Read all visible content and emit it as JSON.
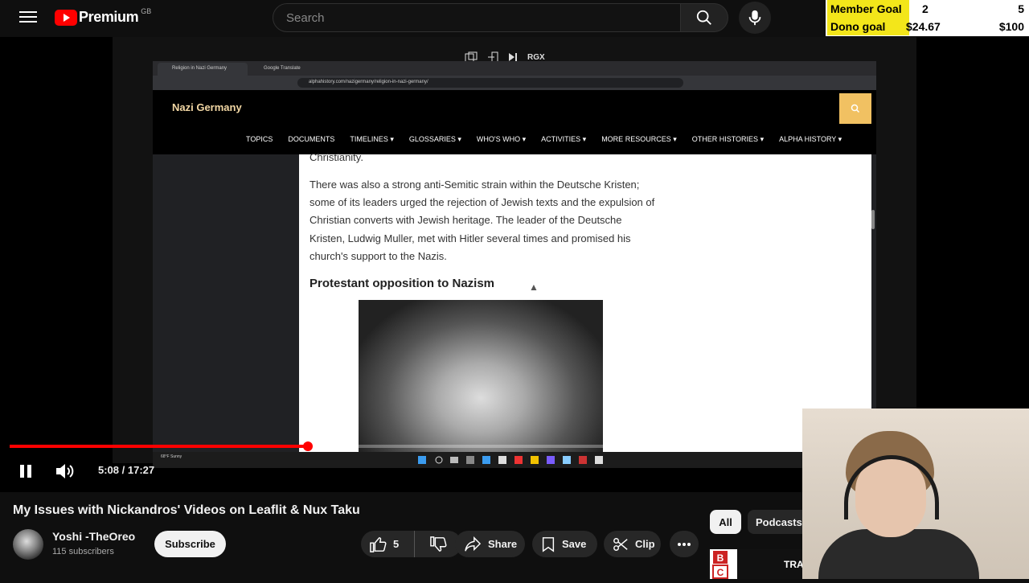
{
  "header": {
    "brand": "Premium",
    "region": "GB",
    "search_placeholder": "Search"
  },
  "goals": [
    {
      "label": "Member Goal",
      "current": "2",
      "target": "5"
    },
    {
      "label": "Dono goal",
      "current": "$24.67",
      "target": "$100"
    }
  ],
  "embedded_browser": {
    "tabs": [
      "Religion in Nazi Germany",
      "Google Translate"
    ],
    "url": "alphahistory.com/nazigermany/religion-in-nazi-germany/",
    "toolbar_label": "RGX",
    "site_title": "Nazi Germany",
    "nav": [
      "TOPICS",
      "DOCUMENTS",
      "TIMELINES ▾",
      "GLOSSARIES ▾",
      "WHO'S WHO ▾",
      "ACTIVITIES ▾",
      "MORE RESOURCES ▾",
      "OTHER HISTORIES ▾",
      "ALPHA HISTORY ▾"
    ],
    "paragraph_top": "Christianity.",
    "paragraph_1": "There was also a strong anti-Semitic strain within the Deutsche Kristen; some of its leaders urged the rejection of Jewish texts and the expulsion of Christian converts with Jewish heritage. The leader of the Deutsche Kristen, Ludwig Muller, met with Hitler several times and promised his church's support to the Nazis.",
    "subheading": "Protestant opposition to Nazism",
    "taskbar_weather": "68°F Sunny"
  },
  "player": {
    "time_current": "5:08",
    "time_total": "17:27",
    "time_display": "5:08 / 17:27",
    "progress_played": 0.376,
    "progress_loaded": 0.41
  },
  "video": {
    "title": "My Issues with Nickandros' Videos on Leaflit & Nux Taku",
    "channel": "Yoshi -TheOreo",
    "subscribers": "115 subscribers",
    "subscribe_label": "Subscribe",
    "likes": "5",
    "share_label": "Share",
    "save_label": "Save",
    "clip_label": "Clip"
  },
  "chips": [
    "All",
    "Podcasts"
  ],
  "thumb_partial_text": "TRA",
  "thumb_logo_text": "B C"
}
